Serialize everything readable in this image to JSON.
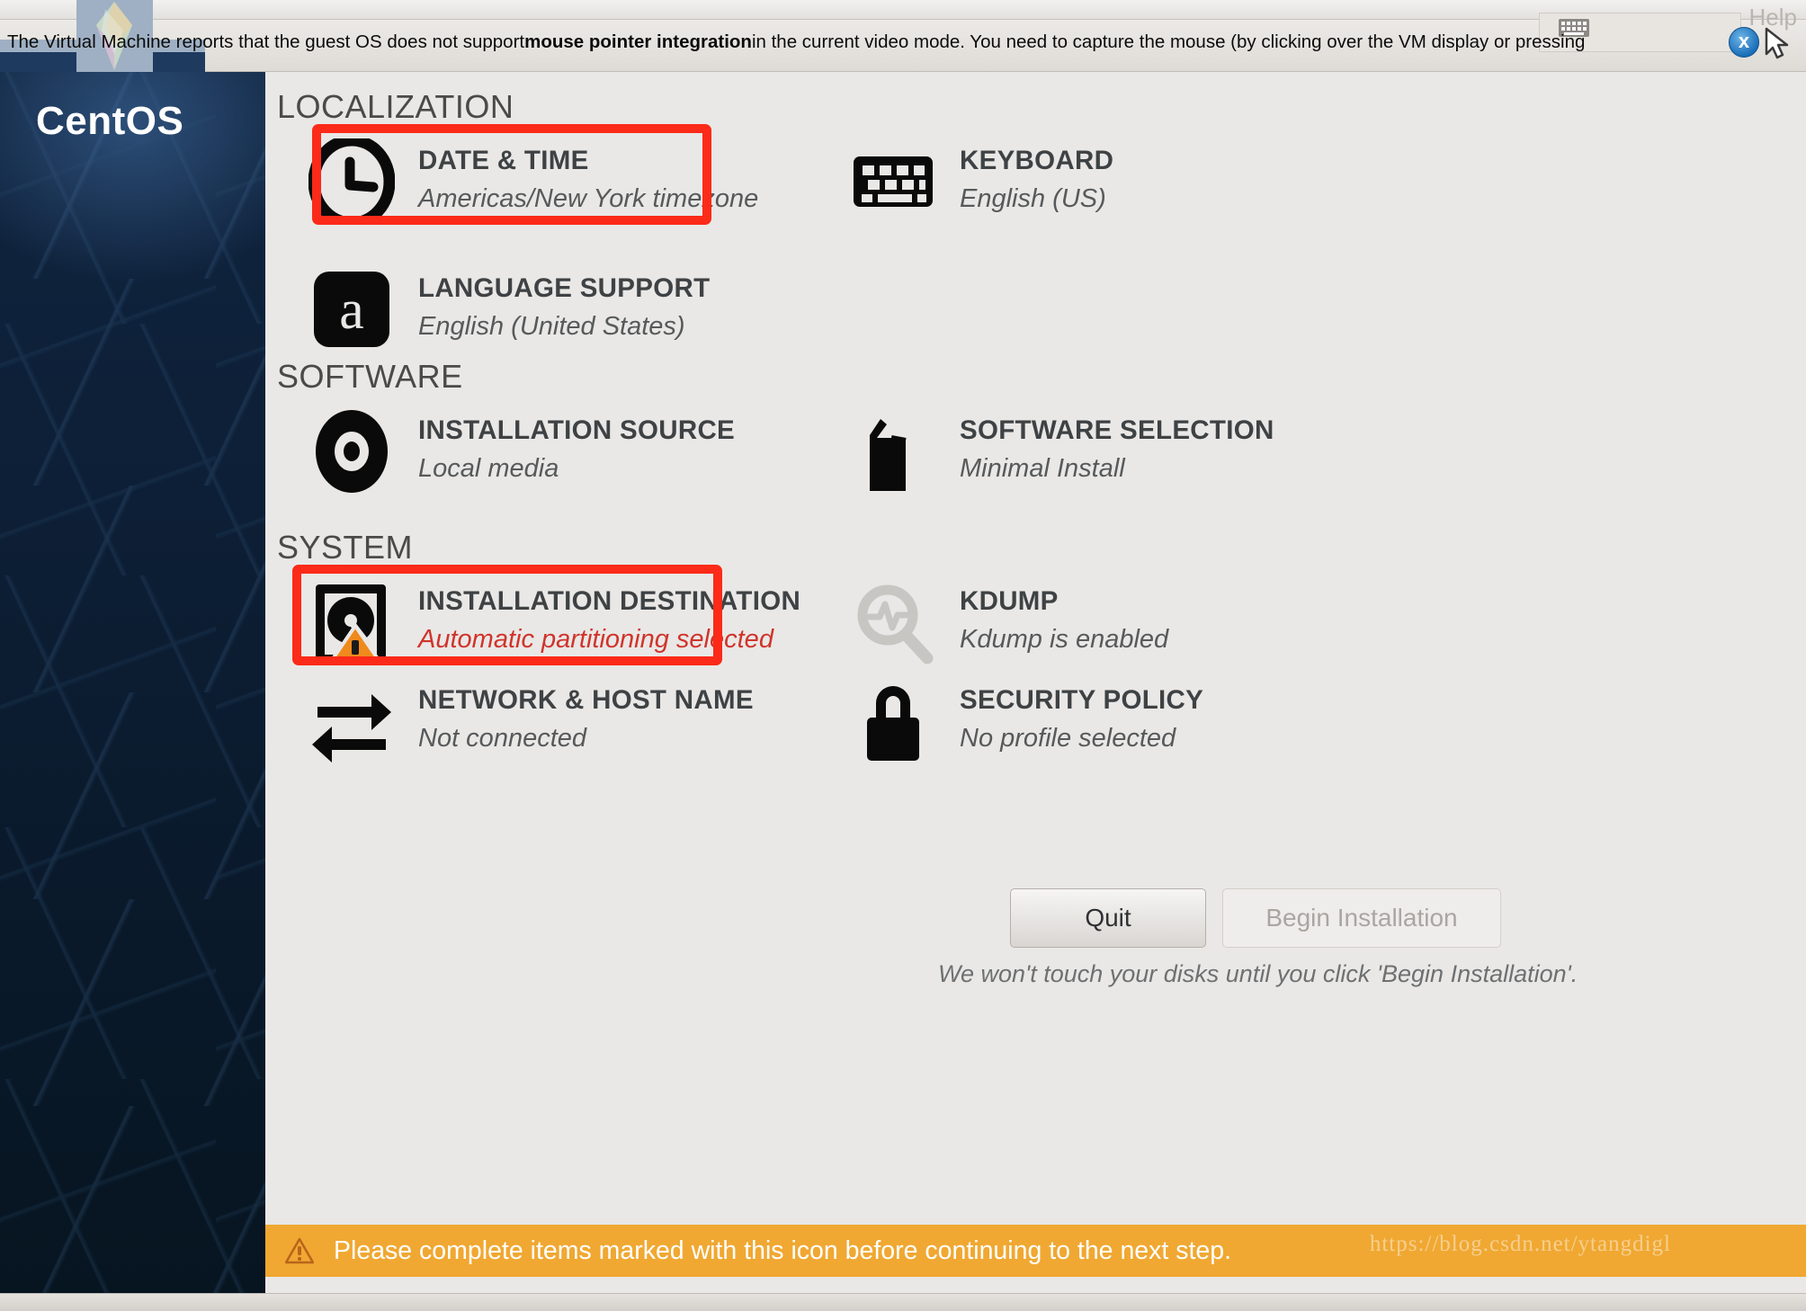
{
  "host_window": {
    "title": "",
    "help_label": "Help",
    "close_button": "x",
    "keyboard_icon": "keyboard-icon",
    "mouse_icon": "mouse-pointer-icon"
  },
  "notification": {
    "text_before": "The Virtual Machine reports that the guest OS does not support ",
    "emphasis": "mouse pointer integration",
    "text_after": " in the current video mode. You need to capture the mouse (by clicking over the VM display or pressing"
  },
  "sidebar": {
    "brand": "CentOS"
  },
  "sections": [
    {
      "id": "localization",
      "title": "LOCALIZATION",
      "items": [
        {
          "id": "date-time",
          "title": "DATE & TIME",
          "status": "Americas/New York timezone",
          "icon": "clock-icon",
          "highlighted": true,
          "warning": false,
          "disabled": false
        },
        {
          "id": "keyboard",
          "title": "KEYBOARD",
          "status": "English (US)",
          "icon": "keyboard-icon",
          "highlighted": false,
          "warning": false,
          "disabled": false
        },
        {
          "id": "language-support",
          "title": "LANGUAGE SUPPORT",
          "status": "English (United States)",
          "icon": "language-icon",
          "highlighted": false,
          "warning": false,
          "disabled": false
        }
      ]
    },
    {
      "id": "software",
      "title": "SOFTWARE",
      "items": [
        {
          "id": "installation-source",
          "title": "INSTALLATION SOURCE",
          "status": "Local media",
          "icon": "disc-icon",
          "highlighted": false,
          "warning": false,
          "disabled": false
        },
        {
          "id": "software-selection",
          "title": "SOFTWARE SELECTION",
          "status": "Minimal Install",
          "icon": "package-icon",
          "highlighted": false,
          "warning": false,
          "disabled": false
        }
      ]
    },
    {
      "id": "system",
      "title": "SYSTEM",
      "items": [
        {
          "id": "installation-destination",
          "title": "INSTALLATION DESTINATION",
          "status": "Automatic partitioning selected",
          "icon": "harddrive-icon",
          "highlighted": true,
          "warning": true,
          "disabled": false
        },
        {
          "id": "kdump",
          "title": "KDUMP",
          "status": "Kdump is enabled",
          "icon": "magnifier-pulse-icon",
          "highlighted": false,
          "warning": false,
          "disabled": true
        },
        {
          "id": "network-host-name",
          "title": "NETWORK & HOST NAME",
          "status": "Not connected",
          "icon": "network-arrows-icon",
          "highlighted": false,
          "warning": false,
          "disabled": false
        },
        {
          "id": "security-policy",
          "title": "SECURITY POLICY",
          "status": "No profile selected",
          "icon": "lock-icon",
          "highlighted": false,
          "warning": false,
          "disabled": false
        }
      ]
    }
  ],
  "footer": {
    "quit_label": "Quit",
    "begin_label": "Begin Installation",
    "note": "We won't touch your disks until you click 'Begin Installation'."
  },
  "warning_bar": {
    "icon": "warning-triangle-icon",
    "text": "Please complete items marked with this icon before continuing to the next step.",
    "watermark": "https://blog.csdn.net/ytangdigl"
  },
  "colors": {
    "accent_red": "#fc2a18",
    "warn_orange": "#f0a832",
    "status_warn_text": "#d0342c",
    "panel_bg": "#e9e8e6",
    "sidebar_dark": "#0d1f36"
  }
}
